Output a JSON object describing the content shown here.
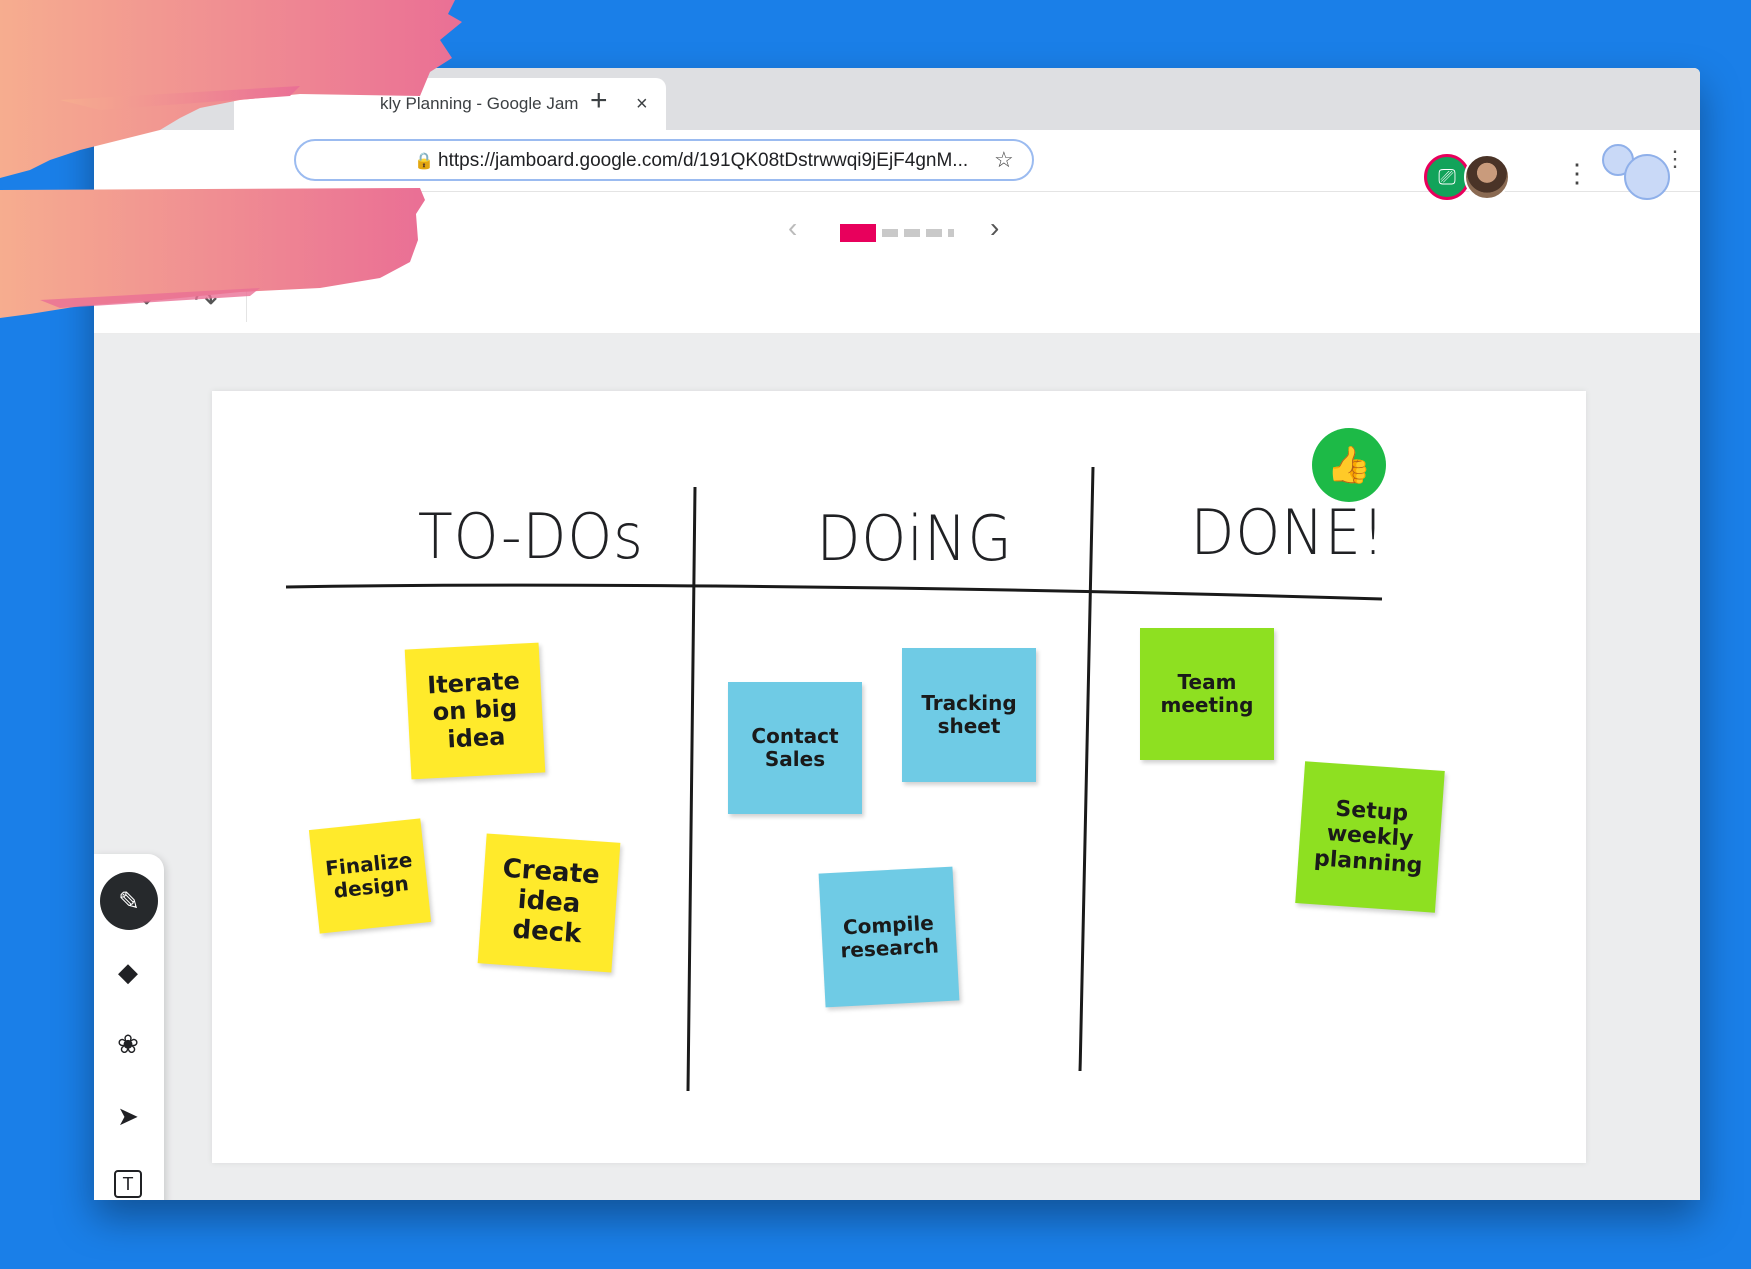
{
  "browser": {
    "tab_title": "kly Planning - Google Jam",
    "tab_close": "×",
    "new_tab": "+",
    "url": "https://jamboard.google.com/d/191QK08tDstrwwqi9jEjF4gnM...",
    "lock_icon": "🔒",
    "star_icon": "☆",
    "menu_icon": "⋮"
  },
  "toolbar": {
    "prev_frame": "‹",
    "next_frame": "›",
    "frames_total": 5,
    "active_frame": 1,
    "menu_icon": "⋮",
    "present_icon": "⎚",
    "undo_icon": "↶",
    "redo_icon": "↷"
  },
  "tools": [
    {
      "name": "pen-tool",
      "glyph": "✎",
      "active": true
    },
    {
      "name": "eraser-tool",
      "glyph": "◆"
    },
    {
      "name": "palette-tool",
      "glyph": "❀"
    },
    {
      "name": "select-tool",
      "glyph": "➤"
    },
    {
      "name": "text-tool",
      "glyph": "T"
    }
  ],
  "board": {
    "columns": [
      {
        "title": "TO-DOs"
      },
      {
        "title": "DOiNG"
      },
      {
        "title": "DONE!"
      }
    ],
    "badge_icon": "👍",
    "notes": [
      {
        "text": "Iterate on big idea",
        "color": "yellow",
        "column": "TO-DOs"
      },
      {
        "text": "Finalize design",
        "color": "yellow",
        "column": "TO-DOs"
      },
      {
        "text": "Create idea deck",
        "color": "yellow",
        "column": "TO-DOs"
      },
      {
        "text": "Contact Sales",
        "color": "blue",
        "column": "DOiNG"
      },
      {
        "text": "Tracking sheet",
        "color": "blue",
        "column": "DOiNG"
      },
      {
        "text": "Compile research",
        "color": "blue",
        "column": "DOiNG"
      },
      {
        "text": "Team meeting",
        "color": "green",
        "column": "DONE!"
      },
      {
        "text": "Setup weekly planning",
        "color": "green",
        "column": "DONE!"
      }
    ]
  },
  "colors": {
    "background": "#1a7fe8",
    "accent_pink": "#e8005c",
    "note_yellow": "#ffea2b",
    "note_blue": "#6fcbe5",
    "note_green": "#8ee021",
    "badge_green": "#1dba47"
  }
}
